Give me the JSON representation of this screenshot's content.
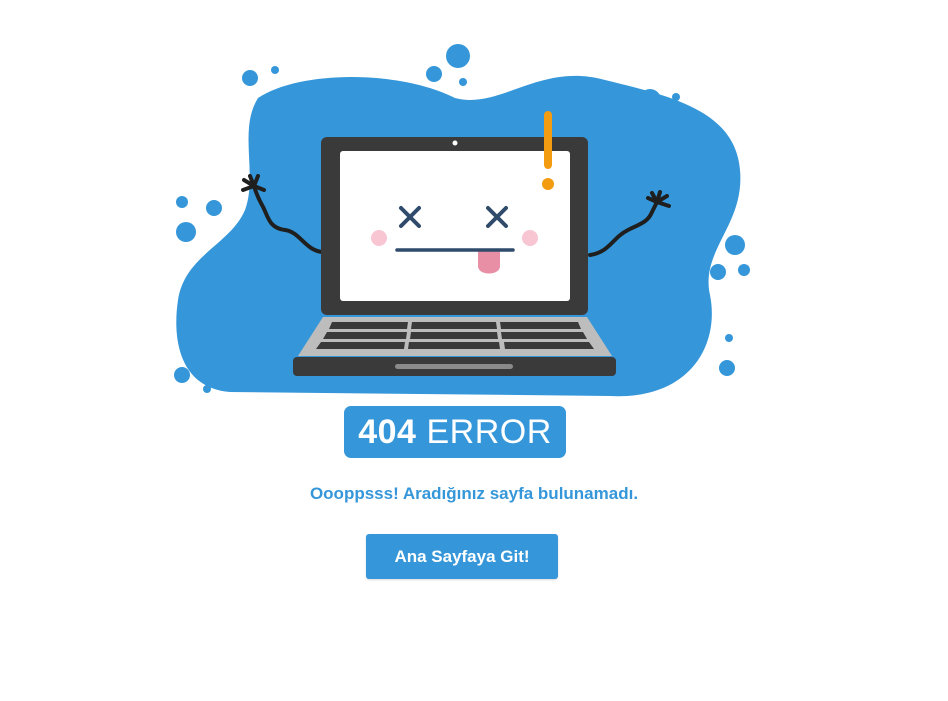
{
  "error": {
    "code": "404",
    "word": "ERROR"
  },
  "message": "Oooppsss! Aradığınız sayfa bulunamadı.",
  "home_button": {
    "label": "Ana Sayfaya Git!"
  },
  "illustration": {
    "subject": "broken-laptop-icon"
  },
  "colors": {
    "brand_blue": "#3597d9",
    "laptop_dark": "#3a3a3a",
    "exclamation": "#f39c12",
    "tongue": "#e88fa6"
  }
}
